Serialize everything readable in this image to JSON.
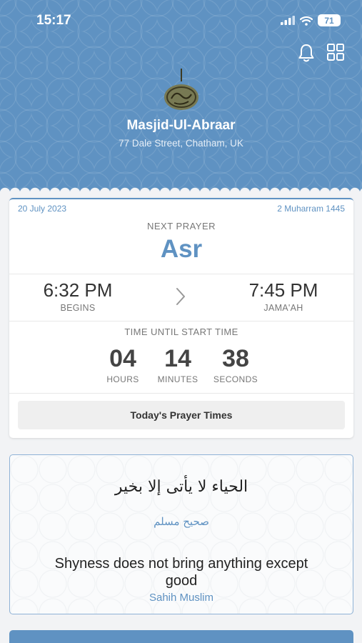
{
  "status_bar": {
    "time": "15:17",
    "battery": "71"
  },
  "header": {
    "mosque_name": "Masjid-Ul-Abraar",
    "address": "77 Dale Street, Chatham, UK"
  },
  "prayer_card": {
    "gregorian_date": "20 July 2023",
    "hijri_date": "2 Muharram 1445",
    "next_prayer_label": "NEXT PRAYER",
    "next_prayer": "Asr",
    "begins_time": "6:32 PM",
    "begins_label": "BEGINS",
    "jamaah_time": "7:45 PM",
    "jamaah_label": "JAMA'AH",
    "countdown_label": "TIME UNTIL START TIME",
    "hours": "04",
    "hours_label": "HOURS",
    "minutes": "14",
    "minutes_label": "MINUTES",
    "seconds": "38",
    "seconds_label": "SECONDS",
    "button_label": "Today's Prayer Times"
  },
  "hadith": {
    "arabic": "الحياء لا يأتى إلا بخير",
    "arabic_source": "صحيح مسلم",
    "english": "Shyness does not bring anything except good",
    "source": "Sahih Muslim"
  },
  "icons": {
    "bell": "bell-icon",
    "grid": "grid-icon",
    "logo": "mosque-logo",
    "arrow": "chevron-right-icon"
  },
  "colors": {
    "accent": "#5f92c2",
    "background": "#f2f3f5"
  }
}
